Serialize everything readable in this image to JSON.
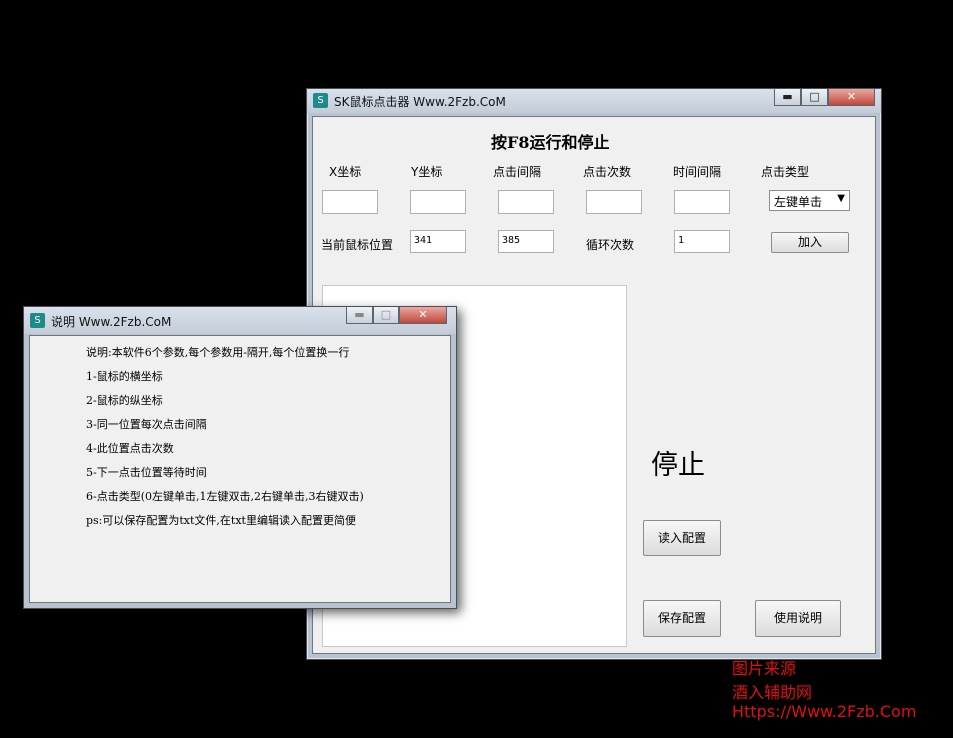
{
  "main_window": {
    "title": "SK鼠标点击器  Www.2Fzb.CoM",
    "minimize": "▬",
    "maximize": "□",
    "close": "✕",
    "heading": "按F8运行和停止",
    "columns": [
      "X坐标",
      "Y坐标",
      "点击间隔",
      "点击次数",
      "时间间隔",
      "点击类型"
    ],
    "click_type_value": "左键单击",
    "current_pos_label": "当前鼠标位置",
    "cur_x": "341",
    "cur_y": "385",
    "loop_label": "循环次数",
    "loop_value": "1",
    "add_button": "加入",
    "status": "停止",
    "load_button": "读入配置",
    "save_button": "保存配置",
    "help_button": "使用说明"
  },
  "help_window": {
    "title": "说明  Www.2Fzb.CoM",
    "lines": [
      "说明:本软件6个参数,每个参数用-隔开,每个位置换一行",
      "1-鼠标的横坐标",
      "2-鼠标的纵坐标",
      "3-同一位置每次点击间隔",
      "4-此位置点击次数",
      "5-下一点击位置等待时间",
      "6-点击类型(0左键单击,1左键双击,2右键单击,3右键双击)",
      "ps:可以保存配置为txt文件,在txt里编辑读入配置更简便"
    ]
  },
  "watermark": {
    "line1": "图片来源",
    "line2": "酒入辅助网",
    "line3": "Https://Www.2Fzb.Com"
  }
}
